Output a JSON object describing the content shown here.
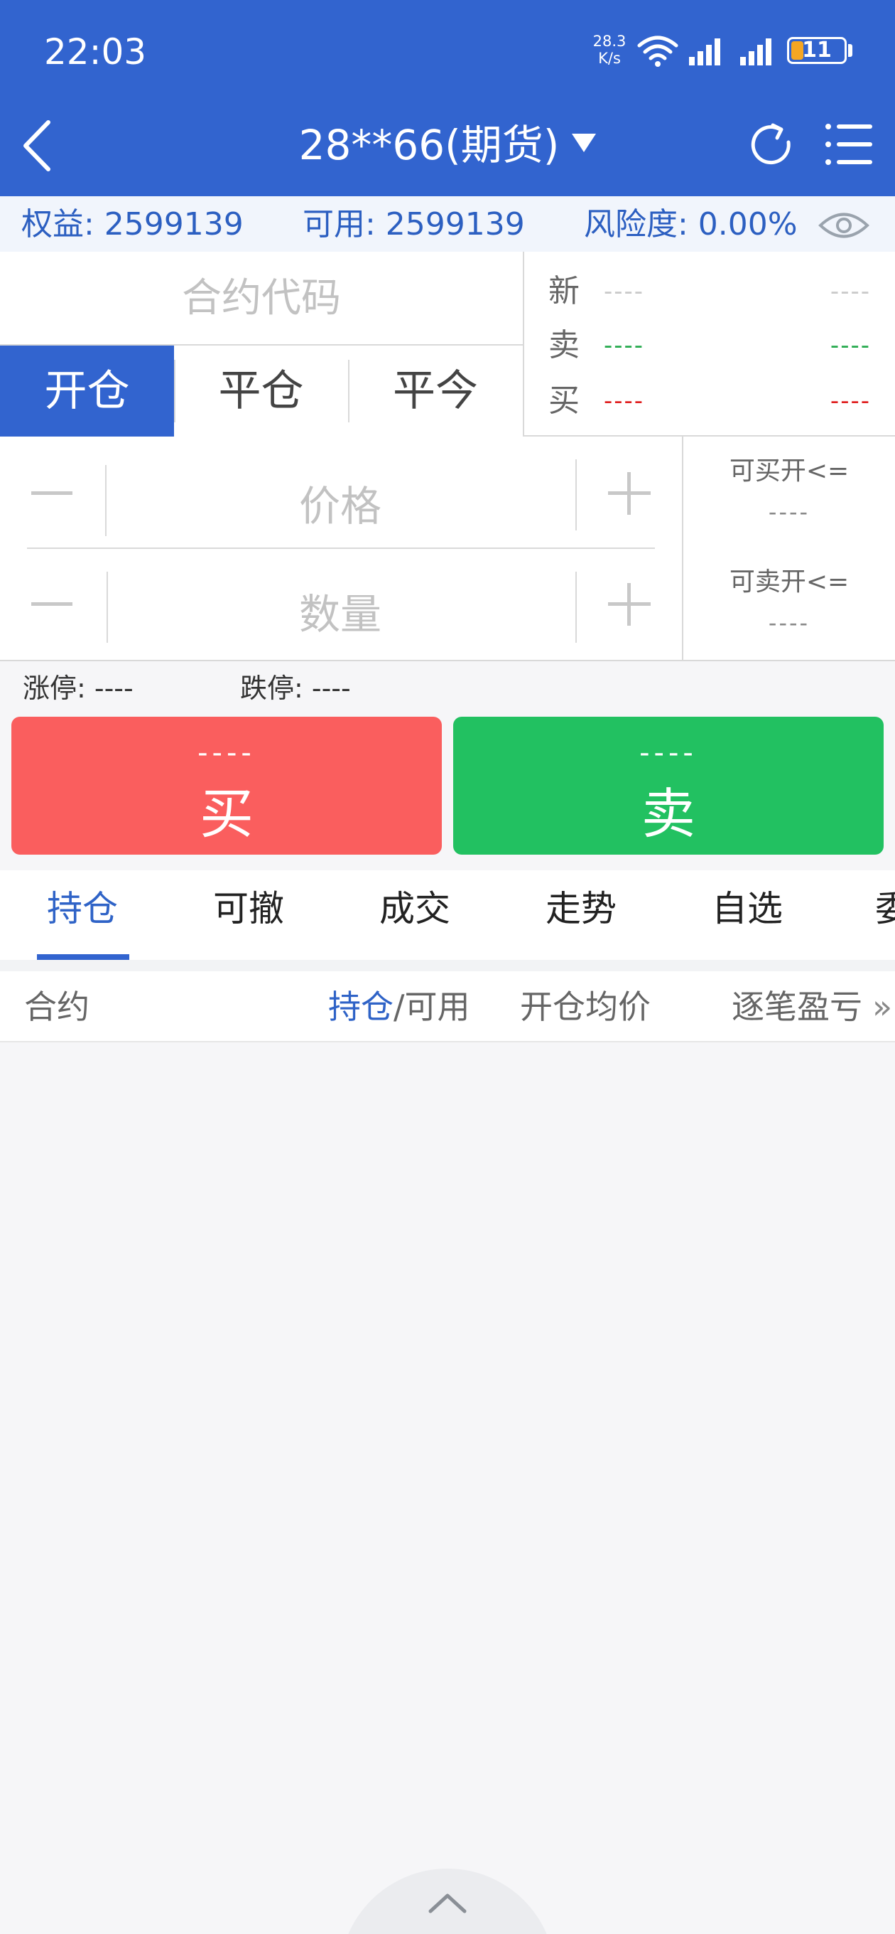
{
  "status_bar": {
    "time": "22:03",
    "net_speed_value": "28.3",
    "net_speed_unit": "K/s",
    "battery": "11",
    "battery_level": 0.11,
    "battery_color": "#f5a623"
  },
  "nav": {
    "title": "28**66(期货)",
    "icons": [
      "back-icon",
      "refresh-icon",
      "menu-icon"
    ]
  },
  "account": {
    "equity": "权益: 2599139",
    "available": "可用: 2599139",
    "risk": "风险度: 0.00%"
  },
  "order": {
    "contract_placeholder": "合约代码",
    "modes": [
      "开仓",
      "平仓",
      "平今"
    ],
    "active_mode": "开仓",
    "quote": {
      "rows": [
        {
          "label": "新",
          "left": "----",
          "right": "----",
          "color": "#c8c8c8"
        },
        {
          "label": "卖",
          "left": "----",
          "right": "----",
          "color": "#22a84a"
        },
        {
          "label": "买",
          "left": "----",
          "right": "----",
          "color": "#e02020"
        }
      ]
    },
    "price_placeholder": "价格",
    "quantity_placeholder": "数量",
    "can_buy_open_label": "可买开<=",
    "can_buy_open_value": "----",
    "can_sell_open_label": "可卖开<=",
    "can_sell_open_value": "----",
    "limit_up": "涨停: ----",
    "limit_down": "跌停: ----",
    "buy": {
      "price": "----",
      "label": "买",
      "color": "#fa5e5e"
    },
    "sell": {
      "price": "----",
      "label": "卖",
      "color": "#22c161"
    }
  },
  "tabs": {
    "items": [
      "持仓",
      "可撤",
      "成交",
      "走势",
      "自选",
      "委"
    ],
    "active": "持仓"
  },
  "table": {
    "col_contract": "合约",
    "col_position_highlight": "持仓",
    "col_position_rest": "/可用",
    "col_avg_price": "开仓均价",
    "col_pnl": "逐笔盈亏",
    "more": "»"
  },
  "colors": {
    "brand": "#3264cf",
    "buy": "#fa5e5e",
    "sell": "#22c161"
  }
}
